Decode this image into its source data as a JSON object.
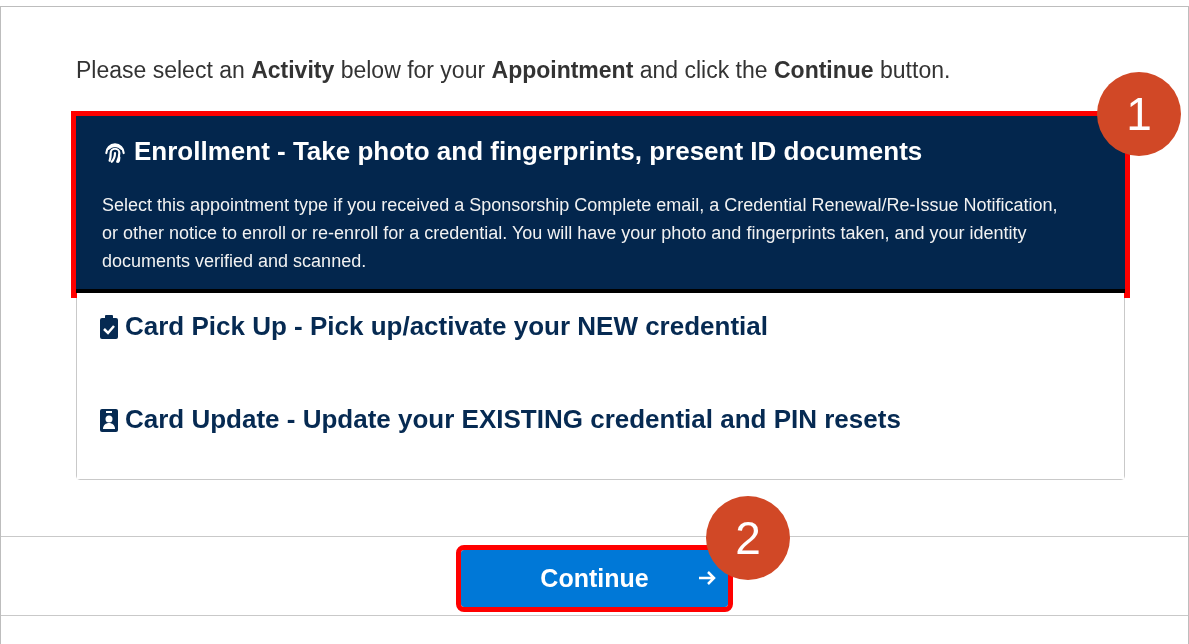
{
  "instruction": "Please select an **Activity** below for your **Appointment** and click the **Continue** button.",
  "activities": [
    {
      "title": "Enrollment - Take photo and fingerprints, present ID documents",
      "description": "Select this appointment type if you received a Sponsorship Complete email, a Credential Renewal/Re-Issue Notification, or other notice to enroll or re-enroll for a credential. You will have your photo and fingerprints taken, and your identity documents verified and scanned.",
      "selected": true,
      "highlighted": true,
      "callout": "1"
    },
    {
      "title": "Card Pick Up - Pick up/activate your NEW credential",
      "selected": false,
      "highlighted": false
    },
    {
      "title": "Card Update - Update your EXISTING credential and PIN resets",
      "selected": false,
      "highlighted": false
    }
  ],
  "continue_button": {
    "label": "Continue",
    "highlighted": true,
    "callout": "2"
  }
}
